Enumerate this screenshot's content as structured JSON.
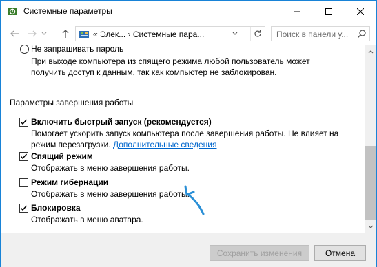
{
  "window": {
    "title": "Системные параметры"
  },
  "nav": {
    "breadcrumb_sep": "«",
    "crumb1": "Элек...",
    "crumb_arrow": "›",
    "crumb2": "Системные пара...",
    "search_placeholder": "Поиск в панели у..."
  },
  "password": {
    "option_label": "Не запрашивать пароль",
    "desc_line1": "При выходе компьютера из спящего режима любой пользователь может",
    "desc_line2": "получить доступ к данным, так как компьютер не заблокирован."
  },
  "shutdown": {
    "section_title": "Параметры завершения работы",
    "items": [
      {
        "label": "Включить быстрый запуск (рекомендуется)",
        "checked": true,
        "desc_line1": "Помогает ускорить запуск компьютера после завершения работы. Не влияет на",
        "desc_line2": "режим перезагрузки. ",
        "link": "Дополнительные сведения"
      },
      {
        "label": "Спящий режим",
        "checked": true,
        "desc_line1": "Отображать в меню завершения работы."
      },
      {
        "label": "Режим гибернации",
        "checked": false,
        "desc_line1": "Отображать в меню завершения работы."
      },
      {
        "label": "Блокировка",
        "checked": true,
        "desc_line1": "Отображать в меню аватара."
      }
    ]
  },
  "footer": {
    "save_label": "Сохранить изменения",
    "cancel_label": "Отмена"
  },
  "colors": {
    "accent": "#1883d7",
    "link": "#0066cc",
    "annotation_arrow": "#2a8fd6"
  }
}
